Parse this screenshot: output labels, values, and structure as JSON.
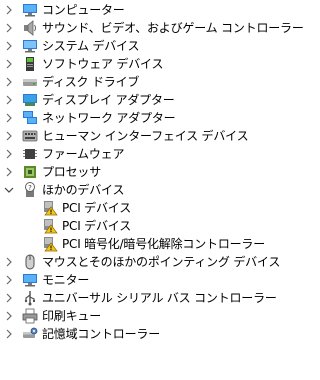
{
  "tree": {
    "items": [
      {
        "label": "コンピューター",
        "icon": "computer-icon"
      },
      {
        "label": "サウンド、ビデオ、およびゲーム コントローラー",
        "icon": "speaker-icon"
      },
      {
        "label": "システム デバイス",
        "icon": "system-devices-icon"
      },
      {
        "label": "ソフトウェア デバイス",
        "icon": "software-device-icon"
      },
      {
        "label": "ディスク ドライブ",
        "icon": "disk-drive-icon"
      },
      {
        "label": "ディスプレイ アダプター",
        "icon": "display-adapter-icon"
      },
      {
        "label": "ネットワーク アダプター",
        "icon": "network-adapter-icon"
      },
      {
        "label": "ヒューマン インターフェイス デバイス",
        "icon": "hid-icon"
      },
      {
        "label": "ファームウェア",
        "icon": "firmware-icon"
      },
      {
        "label": "プロセッサ",
        "icon": "processor-icon"
      },
      {
        "label": "ほかのデバイス",
        "icon": "unknown-device-icon",
        "expanded": true,
        "children": [
          {
            "label": "PCI デバイス",
            "icon": "warning-device-icon"
          },
          {
            "label": "PCI デバイス",
            "icon": "warning-device-icon"
          },
          {
            "label": "PCI 暗号化/暗号化解除コントローラー",
            "icon": "warning-device-icon"
          }
        ]
      },
      {
        "label": "マウスとそのほかのポインティング デバイス",
        "icon": "mouse-icon"
      },
      {
        "label": "モニター",
        "icon": "monitor-icon"
      },
      {
        "label": "ユニバーサル シリアル バス コントローラー",
        "icon": "usb-icon"
      },
      {
        "label": "印刷キュー",
        "icon": "printer-icon"
      },
      {
        "label": "記憶域コントローラー",
        "icon": "storage-controller-icon"
      }
    ]
  }
}
